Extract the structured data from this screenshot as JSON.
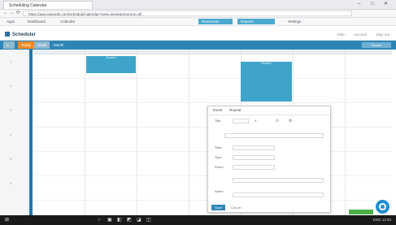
{
  "browser": {
    "tab_title": "Scheduling Calendar",
    "window_controls": [
      "–",
      "□",
      "✕"
    ],
    "nav": [
      "←",
      "→",
      "⟳"
    ],
    "url": "https://app.example.com/schedule/calendar?view=week&resource=all",
    "bookmarks": [
      "Apps",
      "Dashboard",
      "Calendar",
      "Resources",
      "Reports",
      "Settings"
    ],
    "bookmarks_highlighted": [
      "Resources",
      "Reports"
    ]
  },
  "app": {
    "name": "Scheduler",
    "header_links": [
      "Help",
      "Account",
      "Sign out"
    ]
  },
  "toolbar": {
    "buttons": [
      "Today",
      "Week",
      "Month"
    ],
    "right_label": "Search"
  },
  "left_rail": {
    "rows": [
      "1",
      "2",
      "3",
      "4",
      "5",
      "6"
    ]
  },
  "events": [
    {
      "label": "Booked"
    },
    {
      "label": "Booked"
    }
  ],
  "dialog": {
    "tabs": [
      "Event",
      "Repeat"
    ],
    "rows": [
      {
        "label": "Title"
      },
      {
        "label": "Start"
      },
      {
        "label": "Type"
      },
      {
        "label": "Room"
      },
      {
        "label": "Notes"
      }
    ],
    "fields": [
      "",
      "",
      "",
      "",
      ""
    ],
    "save_label": "Save",
    "cancel_label": "Cancel"
  },
  "taskbar": {
    "icons": [
      "⊞",
      "○",
      "▣",
      "◧",
      "◩",
      "◪",
      "◫"
    ],
    "tray": "ENG  12:00"
  },
  "colors": {
    "toolbar_blue": "#2e86b6",
    "event_blue": "#3fa4c9",
    "accent_orange": "#f28a21",
    "help_blue": "#1e8fd0",
    "status_green": "#4bb24a"
  }
}
